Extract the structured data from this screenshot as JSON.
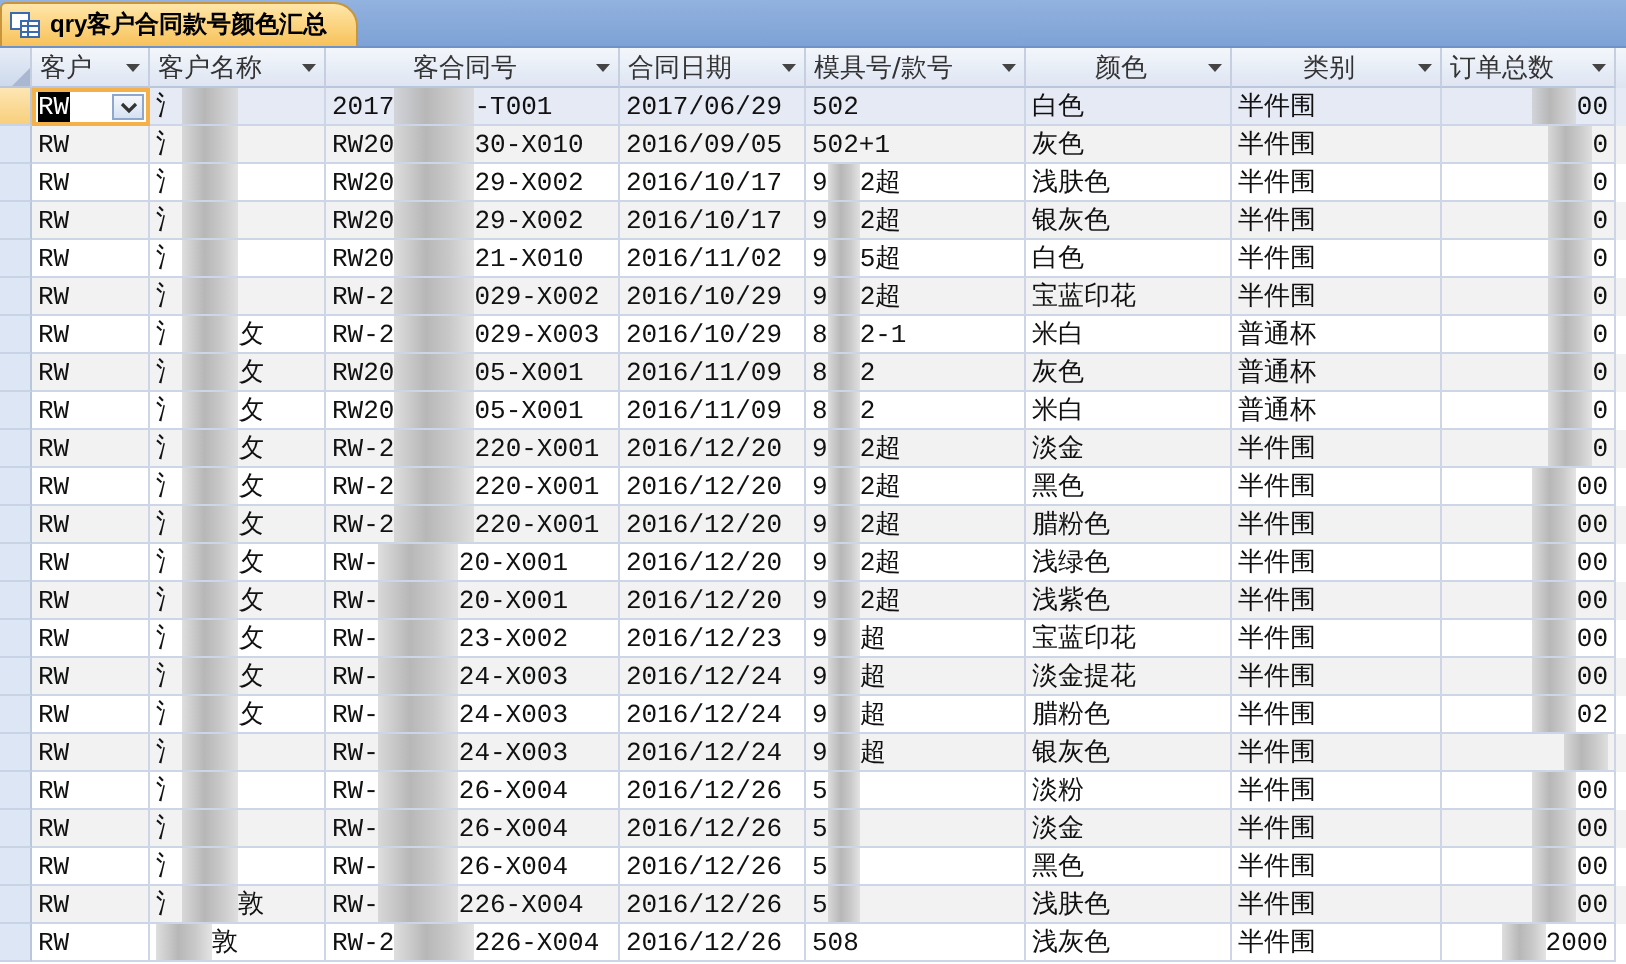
{
  "tab": {
    "title": "qry客户合同款号颜色汇总"
  },
  "columns": [
    {
      "label": "客户"
    },
    {
      "label": "客户名称"
    },
    {
      "label": "客合同号"
    },
    {
      "label": "合同日期"
    },
    {
      "label": "模具号/款号"
    },
    {
      "label": "颜色"
    },
    {
      "label": "类别"
    },
    {
      "label": "订单总数"
    }
  ],
  "rows": [
    {
      "selected": true,
      "cells": [
        "RW",
        {
          "before": "氵"
        },
        {
          "before": "2017",
          "after": "-T001"
        },
        "2017/06/29",
        "502",
        "白色",
        "半件围",
        {
          "after": "00"
        }
      ]
    },
    {
      "selected": false,
      "cells": [
        "RW",
        {
          "before": "氵"
        },
        {
          "before": "RW20",
          "after": "30-X010"
        },
        "2016/09/05",
        "502+1",
        "灰色",
        "半件围",
        {
          "after": "0"
        }
      ]
    },
    {
      "selected": false,
      "cells": [
        "RW",
        {
          "before": "氵"
        },
        {
          "before": "RW20",
          "after": "29-X002"
        },
        "2016/10/17",
        {
          "before": "9",
          "after": "2超"
        },
        "浅肤色",
        "半件围",
        {
          "after": "0"
        }
      ]
    },
    {
      "selected": false,
      "cells": [
        "RW",
        {
          "before": "氵"
        },
        {
          "before": "RW20",
          "after": "29-X002"
        },
        "2016/10/17",
        {
          "before": "9",
          "after": "2超"
        },
        "银灰色",
        "半件围",
        {
          "after": "0"
        }
      ]
    },
    {
      "selected": false,
      "cells": [
        "RW",
        {
          "before": "氵"
        },
        {
          "before": "RW20",
          "after": "21-X010"
        },
        "2016/11/02",
        {
          "before": "9",
          "after": "5超"
        },
        "白色",
        "半件围",
        {
          "after": "0"
        }
      ]
    },
    {
      "selected": false,
      "cells": [
        "RW",
        {
          "before": "氵"
        },
        {
          "before": "RW-2",
          "after": "029-X002"
        },
        "2016/10/29",
        {
          "before": "9",
          "after": "2超"
        },
        "宝蓝印花",
        "半件围",
        {
          "after": "0"
        }
      ]
    },
    {
      "selected": false,
      "cells": [
        "RW",
        {
          "before": "氵",
          "after": "攵"
        },
        {
          "before": "RW-2",
          "after": "029-X003"
        },
        "2016/10/29",
        {
          "before": "8",
          "after": "2-1"
        },
        "米白",
        "普通杯",
        {
          "after": "0"
        }
      ]
    },
    {
      "selected": false,
      "cells": [
        "RW",
        {
          "before": "氵",
          "after": "攵"
        },
        {
          "before": "RW20",
          "after": "05-X001"
        },
        "2016/11/09",
        {
          "before": "8",
          "after": "2"
        },
        "灰色",
        "普通杯",
        {
          "after": "0"
        }
      ]
    },
    {
      "selected": false,
      "cells": [
        "RW",
        {
          "before": "氵",
          "after": "攵"
        },
        {
          "before": "RW20",
          "after": "05-X001"
        },
        "2016/11/09",
        {
          "before": "8",
          "after": "2"
        },
        "米白",
        "普通杯",
        {
          "after": "0"
        }
      ]
    },
    {
      "selected": false,
      "cells": [
        "RW",
        {
          "before": "氵",
          "after": "攵"
        },
        {
          "before": "RW-2",
          "after": "220-X001"
        },
        "2016/12/20",
        {
          "before": "9",
          "after": "2超"
        },
        "淡金",
        "半件围",
        {
          "after": "0"
        }
      ]
    },
    {
      "selected": false,
      "cells": [
        "RW",
        {
          "before": "氵",
          "after": "攵"
        },
        {
          "before": "RW-2",
          "after": "220-X001"
        },
        "2016/12/20",
        {
          "before": "9",
          "after": "2超"
        },
        "黑色",
        "半件围",
        {
          "after": "00"
        }
      ]
    },
    {
      "selected": false,
      "cells": [
        "RW",
        {
          "before": "氵",
          "after": "攵"
        },
        {
          "before": "RW-2",
          "after": "220-X001"
        },
        "2016/12/20",
        {
          "before": "9",
          "after": "2超"
        },
        "腊粉色",
        "半件围",
        {
          "after": "00"
        }
      ]
    },
    {
      "selected": false,
      "cells": [
        "RW",
        {
          "before": "氵",
          "after": "攵"
        },
        {
          "before": "RW-",
          "after": "20-X001"
        },
        "2016/12/20",
        {
          "before": "9",
          "after": "2超"
        },
        "浅绿色",
        "半件围",
        {
          "after": "00"
        }
      ]
    },
    {
      "selected": false,
      "cells": [
        "RW",
        {
          "before": "氵",
          "after": "攵"
        },
        {
          "before": "RW-",
          "after": "20-X001"
        },
        "2016/12/20",
        {
          "before": "9",
          "after": "2超"
        },
        "浅紫色",
        "半件围",
        {
          "after": "00"
        }
      ]
    },
    {
      "selected": false,
      "cells": [
        "RW",
        {
          "before": "氵",
          "after": "攵"
        },
        {
          "before": "RW-",
          "after": "23-X002"
        },
        "2016/12/23",
        {
          "before": "9",
          "after": "超"
        },
        "宝蓝印花",
        "半件围",
        {
          "after": "00"
        }
      ]
    },
    {
      "selected": false,
      "cells": [
        "RW",
        {
          "before": "氵",
          "after": "攵"
        },
        {
          "before": "RW-",
          "after": "24-X003"
        },
        "2016/12/24",
        {
          "before": "9",
          "after": "超"
        },
        "淡金提花",
        "半件围",
        {
          "after": "00"
        }
      ]
    },
    {
      "selected": false,
      "cells": [
        "RW",
        {
          "before": "氵",
          "after": "攵"
        },
        {
          "before": "RW-",
          "after": "24-X003"
        },
        "2016/12/24",
        {
          "before": "9",
          "after": "超"
        },
        "腊粉色",
        "半件围",
        {
          "after": "02"
        }
      ]
    },
    {
      "selected": false,
      "cells": [
        "RW",
        {
          "before": "氵"
        },
        {
          "before": "RW-",
          "after": "24-X003"
        },
        "2016/12/24",
        {
          "before": "9",
          "after": "超"
        },
        "银灰色",
        "半件围",
        {}
      ]
    },
    {
      "selected": false,
      "cells": [
        "RW",
        {
          "before": "氵"
        },
        {
          "before": "RW-",
          "after": "26-X004"
        },
        "2016/12/26",
        {
          "before": "5"
        },
        "淡粉",
        "半件围",
        {
          "after": "00"
        }
      ]
    },
    {
      "selected": false,
      "cells": [
        "RW",
        {
          "before": "氵"
        },
        {
          "before": "RW-",
          "after": "26-X004"
        },
        "2016/12/26",
        {
          "before": "5"
        },
        "淡金",
        "半件围",
        {
          "after": "00"
        }
      ]
    },
    {
      "selected": false,
      "cells": [
        "RW",
        {
          "before": "氵"
        },
        {
          "before": "RW-",
          "after": "26-X004"
        },
        "2016/12/26",
        {
          "before": "5"
        },
        "黑色",
        "半件围",
        {
          "after": "00"
        }
      ]
    },
    {
      "selected": false,
      "cells": [
        "RW",
        {
          "before": "氵",
          "after": "敦"
        },
        {
          "before": "RW-",
          "after": "226-X004"
        },
        "2016/12/26",
        {
          "before": "5"
        },
        "浅肤色",
        "半件围",
        {
          "after": "00"
        }
      ]
    },
    {
      "selected": false,
      "cells": [
        "RW",
        {
          "after": "敦"
        },
        {
          "before": "RW-2",
          "after": "226-X004"
        },
        "2016/12/26",
        "508",
        "浅灰色",
        "半件围",
        {
          "after": "2000"
        }
      ]
    }
  ]
}
